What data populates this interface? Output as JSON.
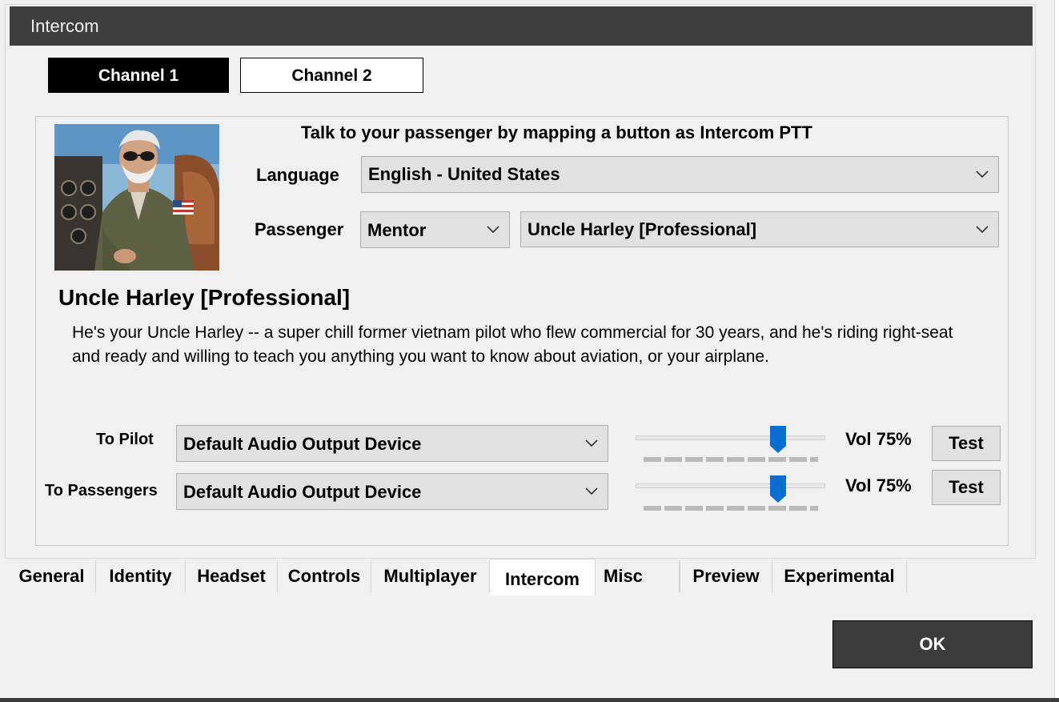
{
  "window": {
    "title": "Intercom"
  },
  "channels": [
    {
      "label": "Channel 1",
      "selected": true
    },
    {
      "label": "Channel 2",
      "selected": false
    }
  ],
  "intercom": {
    "headline": "Talk to your passenger by mapping a button as Intercom PTT",
    "language_label": "Language",
    "language_value": "English - United States",
    "passenger_label": "Passenger",
    "passenger_type_value": "Mentor",
    "passenger_value": "Uncle Harley [Professional]"
  },
  "persona": {
    "name": "Uncle Harley [Professional]",
    "description": "He's your Uncle Harley -- a super chill former vietnam pilot who flew commercial for 30 years, and he's riding right-seat and ready and willing to teach you anything you want to know about aviation, or your airplane."
  },
  "audio": {
    "to_pilot": {
      "label": "To Pilot",
      "device": "Default Audio Output Device",
      "volume_fraction": 0.75,
      "volume_text": "Vol 75%",
      "test_label": "Test"
    },
    "to_passengers": {
      "label": "To Passengers",
      "device": "Default Audio Output Device",
      "volume_fraction": 0.75,
      "volume_text": "Vol 75%",
      "test_label": "Test"
    }
  },
  "tabs": [
    {
      "label": "General",
      "active": false
    },
    {
      "label": "Identity",
      "active": false
    },
    {
      "label": "Headset",
      "active": false
    },
    {
      "label": "Controls",
      "active": false
    },
    {
      "label": "Multiplayer",
      "active": false
    },
    {
      "label": "Intercom",
      "active": true
    },
    {
      "label": "Misc",
      "active": false
    },
    {
      "label": "Preview",
      "active": false
    },
    {
      "label": "Experimental",
      "active": false
    }
  ],
  "footer": {
    "ok_label": "OK"
  },
  "colors": {
    "titlebar_bg": "#3f3f3f",
    "accent_blue": "#0a6ed1",
    "ok_bg": "#3c3c3c"
  },
  "icons": {
    "dropdown": "chevron-down-icon",
    "slider_thumb": "slider-thumb-icon"
  }
}
